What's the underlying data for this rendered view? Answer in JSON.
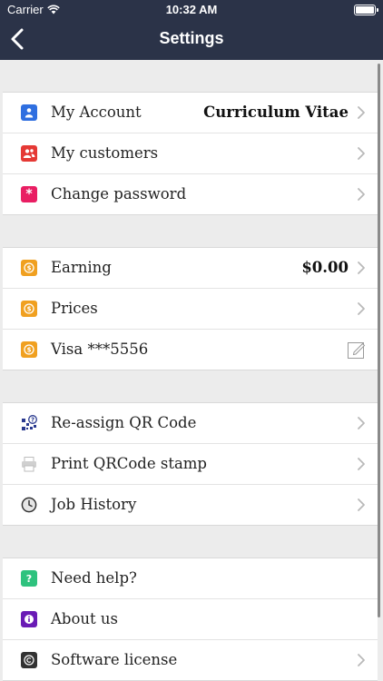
{
  "status": {
    "carrier": "Carrier",
    "time": "10:32 AM"
  },
  "nav": {
    "title": "Settings"
  },
  "groups": [
    [
      {
        "label": "My Account",
        "value": "Curriculum Vitae",
        "icon": "person-icon",
        "color": "#2f6fe0"
      },
      {
        "label": "My customers",
        "icon": "customers-icon",
        "color": "#e53935"
      },
      {
        "label": "Change password",
        "icon": "asterisk-icon",
        "color": "#e91e63"
      }
    ],
    [
      {
        "label": "Earning",
        "value": "$0.00",
        "icon": "dollar-icon",
        "color": "#f0a020"
      },
      {
        "label": "Prices",
        "icon": "dollar-icon",
        "color": "#f0a020"
      },
      {
        "label": "Visa ***5556",
        "icon": "dollar-icon",
        "color": "#f0a020"
      }
    ],
    [
      {
        "label": "Re-assign QR Code",
        "icon": "qr-code-icon",
        "color": "#2a3a8f"
      },
      {
        "label": "Print QRCode stamp",
        "icon": "printer-icon",
        "color": "#c8c8c8"
      },
      {
        "label": "Job History",
        "icon": "clock-icon",
        "color": "#444444"
      }
    ],
    [
      {
        "label": "Need help?",
        "icon": "question-icon",
        "color": "#2ec27e"
      },
      {
        "label": "About us",
        "icon": "info-icon",
        "color": "#6a1bb5"
      },
      {
        "label": "Software license",
        "icon": "copyright-icon",
        "color": "#333333"
      }
    ]
  ]
}
